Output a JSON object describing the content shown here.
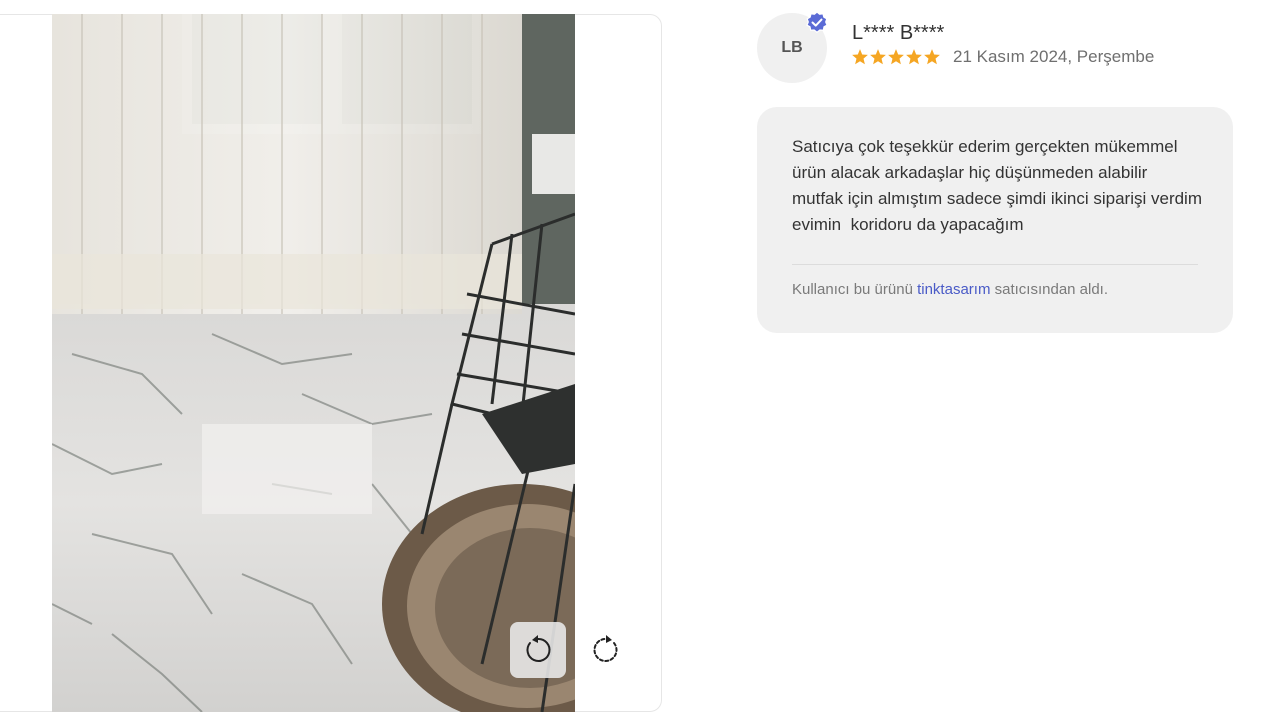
{
  "gallery": {
    "image_alt": "Müşteri fotoğrafı",
    "rotate_left_icon": "rotate-left-icon",
    "rotate_right_icon": "rotate-right-icon"
  },
  "review": {
    "avatar_initials": "LB",
    "verified_icon": "verified-badge-icon",
    "user_name": "L**** B****",
    "rating": 5,
    "rating_max": 5,
    "date": "21 Kasım 2024, Perşembe",
    "comment": "Satıcıya çok teşekkür ederim gerçekten mükemmel ürün alacak arkadaşlar hiç düşünmeden alabilir mutfak için almıştım sadece şimdi ikinci siparişi verdim evimin  koridoru da yapacağım",
    "seller_prefix": "Kullanıcı bu ürünü ",
    "seller_name": "tinktasarım",
    "seller_suffix": " satıcısından aldı."
  },
  "colors": {
    "star": "#f5a623",
    "badge": "#5b6bd6",
    "seller_link": "#4a5bc7",
    "comment_bg": "#f0f0f0"
  }
}
